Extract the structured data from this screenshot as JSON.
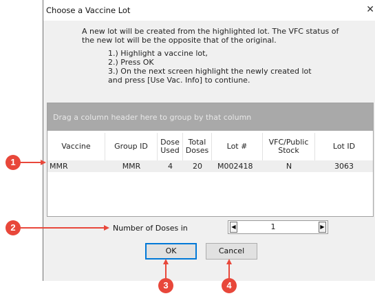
{
  "dialog": {
    "title": "Choose a Vaccine Lot",
    "close_glyph": "✕",
    "instructions": [
      "A new lot will be created from the highlighted lot.  The VFC status of",
      "the new lot will be the opposite that of the original.",
      "1.) Highlight a vaccine lot,",
      "2.) Press OK",
      "3.) On the next screen highlight the newly created lot",
      "and press [Use Vac. Info] to  contiune."
    ]
  },
  "grid": {
    "group_hint": "Drag a column header here to group by that column",
    "columns": [
      "Vaccine",
      "Group ID",
      "Dose Used",
      "Total Doses",
      "Lot #",
      "VFC/Public Stock",
      "Lot ID"
    ],
    "rows": [
      [
        "MMR",
        "MMR",
        "4",
        "20",
        "M002418",
        "N",
        "3063"
      ]
    ]
  },
  "doses": {
    "label": "Number of Doses in New Lo",
    "value": "1"
  },
  "buttons": {
    "ok": "OK",
    "cancel": "Cancel"
  },
  "annotations": {
    "color": "#e8473a",
    "badges": [
      "1",
      "2",
      "3",
      "4"
    ]
  }
}
